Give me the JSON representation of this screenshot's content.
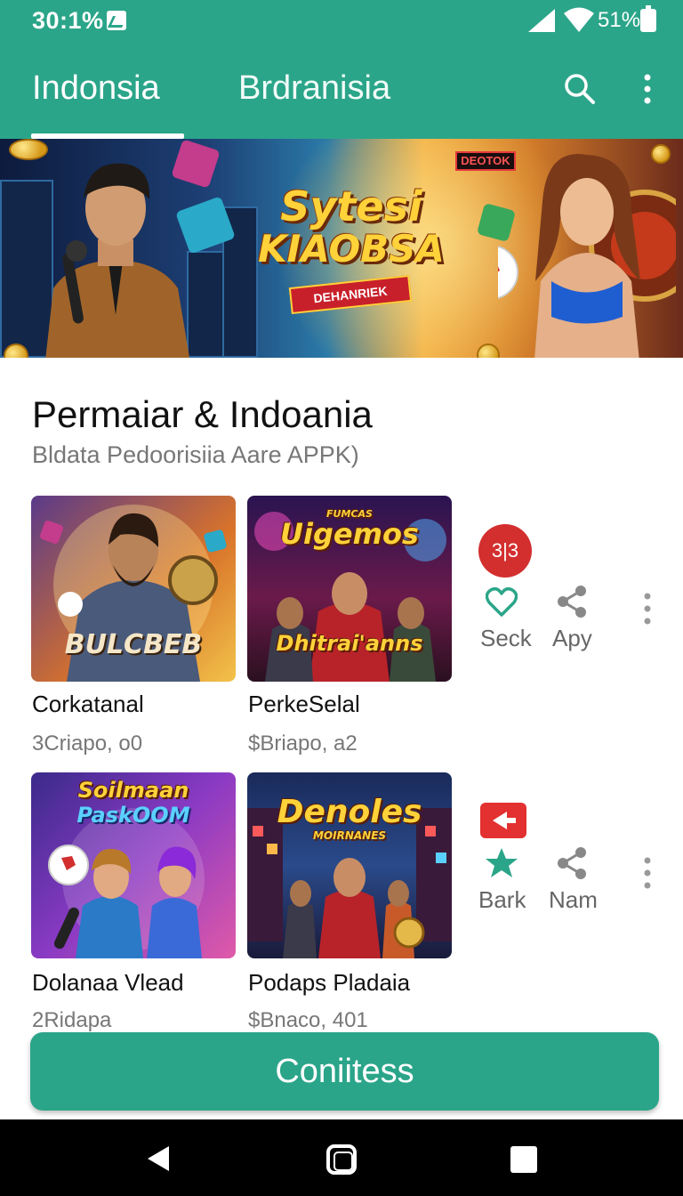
{
  "status_bar": {
    "time": "30:1%",
    "battery": "51%"
  },
  "tabs": [
    {
      "label": "Indonsia"
    },
    {
      "label": "Brdranisia"
    }
  ],
  "banner": {
    "title_line1": "Sytesi",
    "title_line2": "KIAOBSA",
    "ribbon": "DEHANRIEK",
    "badge": "DEOTOK"
  },
  "section": {
    "title": "Permaiar & Indoania",
    "subtitle": "Bldata Pedoorisiia Aare APPK)"
  },
  "cards": [
    {
      "title": "Corkatanal",
      "meta": "3Criapo, o0",
      "art_text": "BULCBEB"
    },
    {
      "title": "PerkeSelal",
      "meta": "$Briapo, a2",
      "art_text_top": "Uigemos",
      "art_text_bottom": "Dhitrai'anns",
      "art_caption": "FUMCAS"
    },
    {
      "title": "Dolanaa Vlead",
      "meta": "2Ridapa",
      "art_text_top": "Soilmaan",
      "art_text_bottom": "PaskOOM"
    },
    {
      "title": "Podaps Pladaia",
      "meta": "$Bnaco, 401",
      "art_text": "Denoles",
      "art_caption": "MOIRNANES"
    }
  ],
  "actions": {
    "row1": {
      "badge": "3|3",
      "like_label": "Seck",
      "share_label": "Apy"
    },
    "row2": {
      "star_label": "Bark",
      "share_label": "Nam"
    }
  },
  "cta_label": "Coniitess",
  "colors": {
    "primary": "#2ba589",
    "accent_red": "#d32f2f"
  }
}
